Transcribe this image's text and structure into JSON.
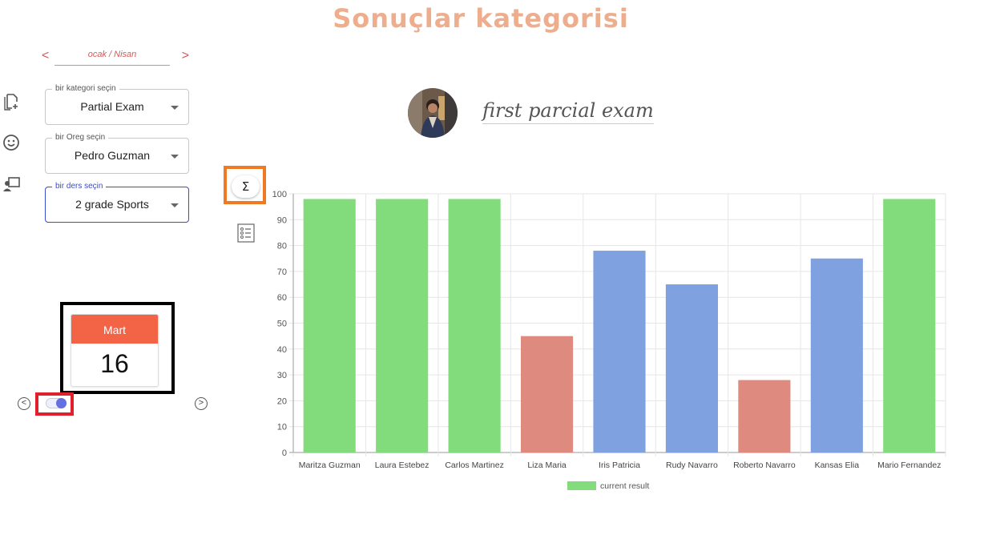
{
  "header": {
    "title": "Sonuçlar kategorisi"
  },
  "month_nav": {
    "prev": "<",
    "label": "ocak / Nisan",
    "next": ">"
  },
  "sidebar": {
    "icons": [
      "add-document-icon",
      "smiley-icon",
      "teacher-board-icon"
    ]
  },
  "filters": {
    "category": {
      "legend": "bir kategori seçin",
      "value": "Partial Exam"
    },
    "oreg": {
      "legend": "bir Oreg seçin",
      "value": "Pedro Guzman"
    },
    "course": {
      "legend": "bir ders seçin",
      "value": "2 grade Sports"
    }
  },
  "calendar": {
    "month": "Mart",
    "day": "16",
    "prev": "<",
    "next": ">"
  },
  "toggle": {
    "state": "on"
  },
  "tools": {
    "sigma_label": "Σ",
    "list_icon": "list-icon"
  },
  "exam": {
    "title": "first parcial exam"
  },
  "colors": {
    "green": "#83dc7c",
    "red": "#df8a7e",
    "blue": "#7fa1df",
    "title": "#eeae8e"
  },
  "chart_data": {
    "type": "bar",
    "categories": [
      "Maritza Guzman",
      "Laura Estebez",
      "Carlos Martinez",
      "Liza Maria",
      "Iris Patricia",
      "Rudy Navarro",
      "Roberto Navarro",
      "Kansas Elia",
      "Mario Fernandez"
    ],
    "series": [
      {
        "name": "current result",
        "values": [
          98,
          98,
          98,
          45,
          78,
          65,
          28,
          75,
          98
        ]
      }
    ],
    "bar_colors": [
      "green",
      "green",
      "green",
      "red",
      "blue",
      "blue",
      "red",
      "blue",
      "green"
    ],
    "ylim": [
      0,
      100
    ],
    "yticks": [
      0,
      10,
      20,
      30,
      40,
      50,
      60,
      70,
      80,
      90,
      100
    ],
    "grid": true,
    "legend": "bottom"
  }
}
